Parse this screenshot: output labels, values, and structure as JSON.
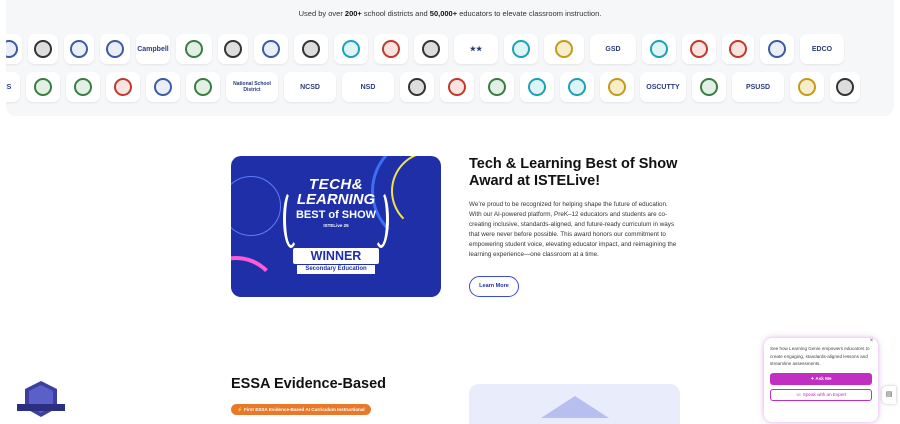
{
  "tagline": {
    "prefix": "Used by over ",
    "districts": "200+",
    "middle": " school districts and ",
    "educators": "50,000+",
    "suffix": " educators to elevate classroom instruction."
  },
  "logos_row1": [
    {
      "label": "",
      "kind": "seal",
      "color": "blue",
      "w": 26
    },
    {
      "label": "",
      "kind": "seal",
      "color": "dark",
      "w": 30
    },
    {
      "label": "",
      "kind": "seal",
      "color": "blue",
      "w": 30
    },
    {
      "label": "",
      "kind": "seal",
      "color": "blue",
      "w": 30
    },
    {
      "label": "Campbell",
      "kind": "text",
      "w": 34
    },
    {
      "label": "",
      "kind": "seal",
      "color": "green",
      "w": 36
    },
    {
      "label": "",
      "kind": "seal",
      "color": "dark",
      "w": 30
    },
    {
      "label": "",
      "kind": "seal",
      "color": "blue",
      "w": 34
    },
    {
      "label": "",
      "kind": "seal",
      "color": "dark",
      "w": 34
    },
    {
      "label": "",
      "kind": "seal",
      "color": "teal",
      "w": 34
    },
    {
      "label": "",
      "kind": "seal",
      "color": "red",
      "w": 34
    },
    {
      "label": "",
      "kind": "seal",
      "color": "dark",
      "w": 34
    },
    {
      "label": "★★",
      "kind": "text",
      "w": 44
    },
    {
      "label": "",
      "kind": "seal",
      "color": "teal",
      "w": 34
    },
    {
      "label": "",
      "kind": "seal",
      "color": "gold",
      "w": 40
    },
    {
      "label": "GSD",
      "kind": "text",
      "w": 46
    },
    {
      "label": "",
      "kind": "seal",
      "color": "teal",
      "w": 34
    },
    {
      "label": "",
      "kind": "seal",
      "color": "red",
      "w": 34
    },
    {
      "label": "",
      "kind": "seal",
      "color": "red",
      "w": 32
    },
    {
      "label": "",
      "kind": "seal",
      "color": "blue",
      "w": 34
    },
    {
      "label": "EDCO",
      "kind": "text",
      "w": 44
    }
  ],
  "logos_row2": [
    {
      "label": "MS",
      "kind": "text",
      "w": 28
    },
    {
      "label": "",
      "kind": "seal",
      "color": "green",
      "w": 34
    },
    {
      "label": "",
      "kind": "seal",
      "color": "green",
      "w": 34
    },
    {
      "label": "",
      "kind": "seal",
      "color": "red",
      "w": 34
    },
    {
      "label": "",
      "kind": "seal",
      "color": "blue",
      "w": 34
    },
    {
      "label": "",
      "kind": "seal",
      "color": "green",
      "w": 34
    },
    {
      "label": "National School District",
      "kind": "text",
      "w": 52
    },
    {
      "label": "NCSD",
      "kind": "text",
      "w": 52
    },
    {
      "label": "NSD",
      "kind": "text",
      "w": 52
    },
    {
      "label": "",
      "kind": "seal",
      "color": "dark",
      "w": 34
    },
    {
      "label": "",
      "kind": "seal",
      "color": "red",
      "w": 34
    },
    {
      "label": "",
      "kind": "seal",
      "color": "green",
      "w": 34
    },
    {
      "label": "",
      "kind": "seal",
      "color": "teal",
      "w": 34
    },
    {
      "label": "",
      "kind": "seal",
      "color": "teal",
      "w": 34
    },
    {
      "label": "",
      "kind": "seal",
      "color": "gold",
      "w": 34
    },
    {
      "label": "OSCUTTY",
      "kind": "text",
      "w": 46
    },
    {
      "label": "",
      "kind": "seal",
      "color": "green",
      "w": 34
    },
    {
      "label": "PSUSD",
      "kind": "text",
      "w": 52
    },
    {
      "label": "",
      "kind": "seal",
      "color": "gold",
      "w": 34
    },
    {
      "label": "",
      "kind": "seal",
      "color": "dark",
      "w": 30
    }
  ],
  "award": {
    "badge_line1": "TECH&",
    "badge_line2": "LEARNING",
    "badge_line3": "BEST of SHOW",
    "badge_line4": "ISTELive 25",
    "winner": "WINNER",
    "category": "Secondary Education",
    "title": "Tech & Learning Best of Show Award at ISTELive!",
    "body": "We’re proud to be recognized for helping shape the future of education. With our AI-powered platform, PreK–12 educators and students are co-creating inclusive, standards-aligned, and future-ready curriculum in ways that were never before possible. This award honors our commitment to empowering student voice, elevating educator impact, and reimagining the learning experience—one classroom at a time.",
    "cta": "Learn More"
  },
  "essa": {
    "title": "ESSA Evidence-Based",
    "pill": "⚡ First ESSA Evidence-Based AI Curriculum Instructional"
  },
  "popup": {
    "close": "×",
    "text": "See how Learning Genie empowers educators to create engaging, standards-aligned lessons and streamline assessments.",
    "primary": "✦ Ask Me",
    "secondary": "☏ Speak with an Expert"
  },
  "side_tab_icon": "chat-icon",
  "colors": {
    "brand_blue": "#1f2fa8",
    "accent_magenta": "#c02fc2",
    "essa_orange": "#e8792a"
  }
}
